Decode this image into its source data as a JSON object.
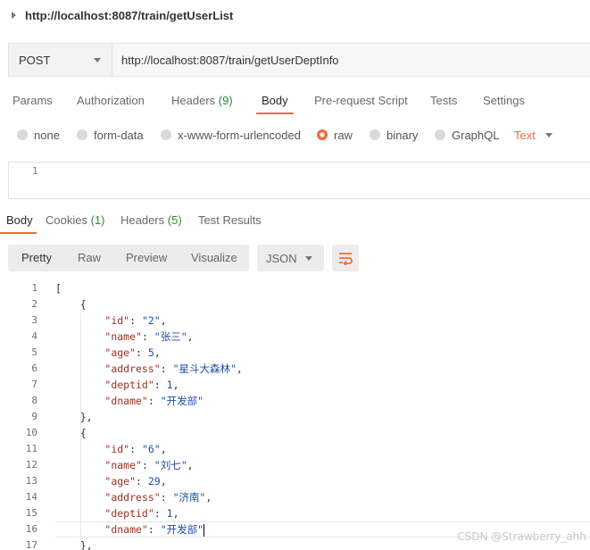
{
  "request": {
    "title": "http://localhost:8087/train/getUserList",
    "method": "POST",
    "url": "http://localhost:8087/train/getUserDeptInfo"
  },
  "request_tabs": [
    {
      "label": "Params"
    },
    {
      "label": "Authorization"
    },
    {
      "label": "Headers",
      "count": "(9)"
    },
    {
      "label": "Body"
    },
    {
      "label": "Pre-request Script"
    },
    {
      "label": "Tests"
    },
    {
      "label": "Settings"
    }
  ],
  "body_types": [
    "none",
    "form-data",
    "x-www-form-urlencoded",
    "raw",
    "binary",
    "GraphQL"
  ],
  "body_format": "Text",
  "editor": {
    "line_number": "1"
  },
  "response_tabs": [
    {
      "label": "Body"
    },
    {
      "label": "Cookies",
      "count": "(1)"
    },
    {
      "label": "Headers",
      "count": "(5)"
    },
    {
      "label": "Test Results"
    }
  ],
  "view_modes": [
    "Pretty",
    "Raw",
    "Preview",
    "Visualize"
  ],
  "response_format": "JSON",
  "response_lines": [
    {
      "n": "1",
      "text": "["
    },
    {
      "n": "2",
      "text": "    {"
    },
    {
      "n": "3",
      "key": "\"id\"",
      "value": "\"2\"",
      "indent": 2
    },
    {
      "n": "4",
      "key": "\"name\"",
      "value": "\"张三\"",
      "indent": 2
    },
    {
      "n": "5",
      "key": "\"age\"",
      "value": "5",
      "indent": 2
    },
    {
      "n": "6",
      "key": "\"address\"",
      "value": "\"星斗大森林\"",
      "indent": 2
    },
    {
      "n": "7",
      "key": "\"deptid\"",
      "value": "1",
      "indent": 2
    },
    {
      "n": "8",
      "key": "\"dname\"",
      "value": "\"开发部\"",
      "indent": 2,
      "last": true
    },
    {
      "n": "9",
      "text": "    },"
    },
    {
      "n": "10",
      "text": "    {"
    },
    {
      "n": "11",
      "key": "\"id\"",
      "value": "\"6\"",
      "indent": 2
    },
    {
      "n": "12",
      "key": "\"name\"",
      "value": "\"刘七\"",
      "indent": 2
    },
    {
      "n": "13",
      "key": "\"age\"",
      "value": "29",
      "indent": 2
    },
    {
      "n": "14",
      "key": "\"address\"",
      "value": "\"济南\"",
      "indent": 2
    },
    {
      "n": "15",
      "key": "\"deptid\"",
      "value": "1",
      "indent": 2
    },
    {
      "n": "16",
      "key": "\"dname\"",
      "value": "\"开发部\"",
      "indent": 2,
      "last": true,
      "cursor": true
    },
    {
      "n": "17",
      "text": "    },"
    }
  ],
  "watermark": "CSDN @Strawberry_ahh",
  "colors": {
    "accent": "#f26b3a",
    "count_green": "#2a8a3c",
    "json_key": "#9a2f25",
    "json_value": "#1d4fa8"
  }
}
